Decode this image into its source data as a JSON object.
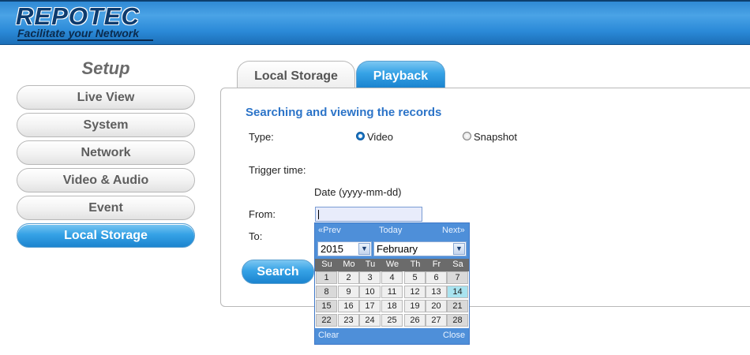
{
  "header": {
    "brand": "REPOTEC",
    "tagline": "Facilitate your Network"
  },
  "sidebar": {
    "title": "Setup",
    "items": [
      {
        "label": "Live View",
        "active": false
      },
      {
        "label": "System",
        "active": false
      },
      {
        "label": "Network",
        "active": false
      },
      {
        "label": "Video & Audio",
        "active": false
      },
      {
        "label": "Event",
        "active": false
      },
      {
        "label": "Local Storage",
        "active": true
      }
    ]
  },
  "tabs": {
    "local_storage": "Local Storage",
    "playback": "Playback"
  },
  "form": {
    "section_title": "Searching and viewing the records",
    "type_label": "Type:",
    "type_video": "Video",
    "type_snapshot": "Snapshot",
    "selected_type": "Video",
    "trigger_label": "Trigger time:",
    "date_hint": "Date (yyyy-mm-dd)",
    "from_label": "From:",
    "to_label": "To:",
    "from_value": "",
    "search_label": "Search"
  },
  "calendar": {
    "prev": "«Prev",
    "today": "Today",
    "next": "Next»",
    "year": "2015",
    "month": "February",
    "dow": [
      "Su",
      "Mo",
      "Tu",
      "We",
      "Th",
      "Fr",
      "Sa"
    ],
    "weeks": [
      [
        "1",
        "2",
        "3",
        "4",
        "5",
        "6",
        "7"
      ],
      [
        "8",
        "9",
        "10",
        "11",
        "12",
        "13",
        "14"
      ],
      [
        "15",
        "16",
        "17",
        "18",
        "19",
        "20",
        "21"
      ],
      [
        "22",
        "23",
        "24",
        "25",
        "26",
        "27",
        "28"
      ]
    ],
    "highlighted_day": "14",
    "clear": "Clear",
    "close": "Close"
  },
  "colors": {
    "accent_blue": "#36a2e6",
    "title_blue": "#2c74c8",
    "calendar_bar": "#4e8fd9"
  }
}
